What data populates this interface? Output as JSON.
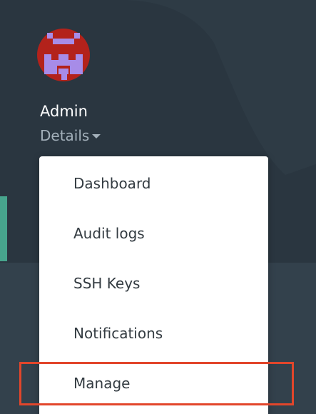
{
  "user": {
    "name": "Admin",
    "details_label": "Details"
  },
  "icons": {
    "avatar": "pixel-identicon-avatar",
    "details_caret": "caret-down-icon"
  },
  "menu": {
    "items": [
      {
        "label": "Dashboard"
      },
      {
        "label": "Audit logs"
      },
      {
        "label": "SSH Keys"
      },
      {
        "label": "Notifications"
      },
      {
        "label": "Manage"
      }
    ]
  },
  "colors": {
    "sidebar_bg": "#2a3640",
    "avatar_bg": "#b3221b",
    "avatar_pattern": "#a78ce8",
    "accent": "#47a58d",
    "highlight": "#e2462b"
  }
}
